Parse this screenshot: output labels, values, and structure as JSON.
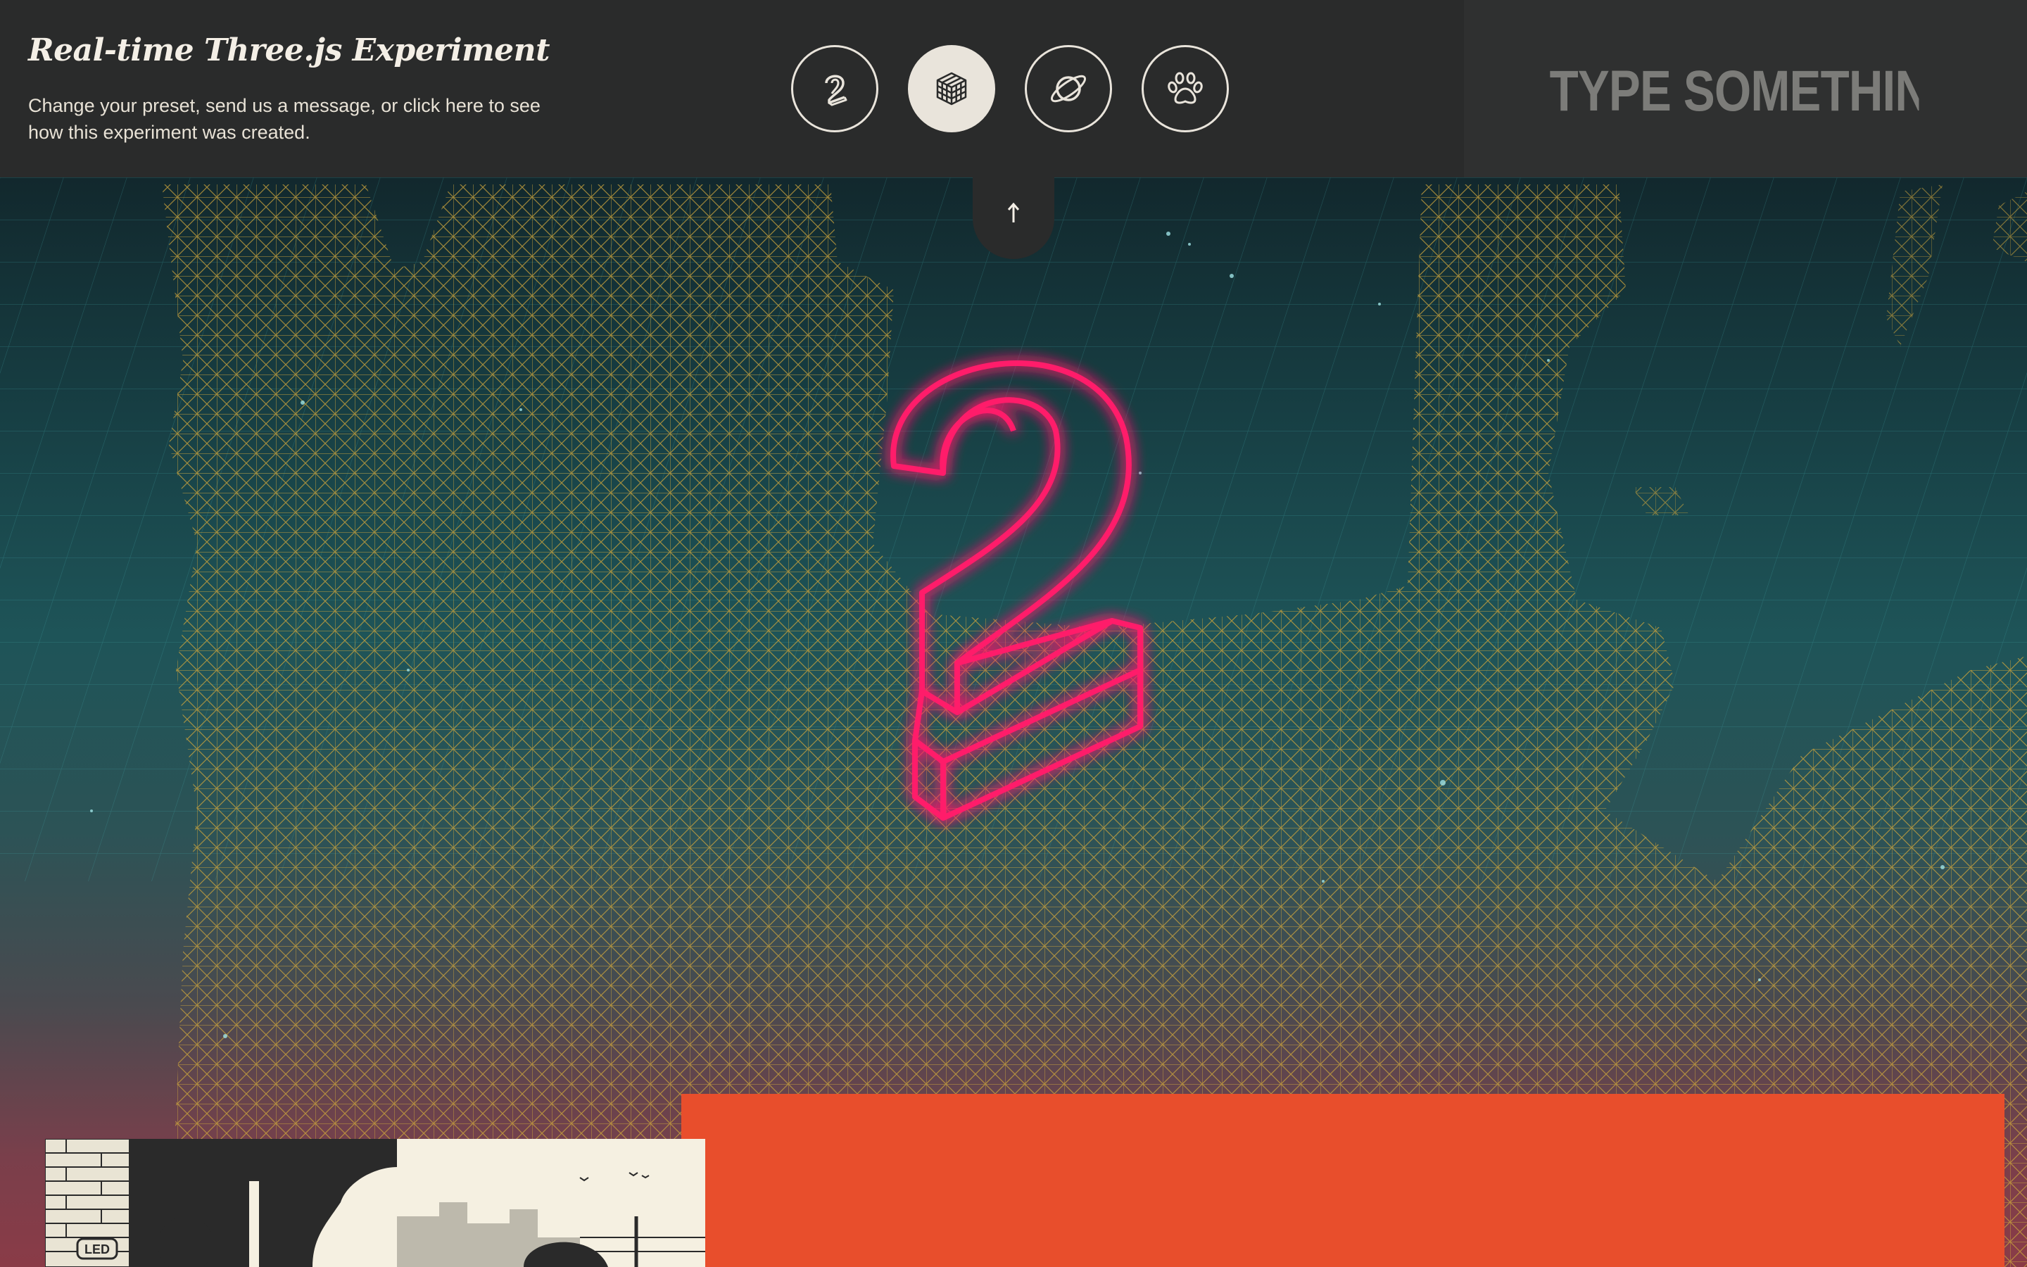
{
  "header": {
    "title": "Real-time Three.js Experiment",
    "description": "Change your preset, send us a message, or click here to see how this experiment was created."
  },
  "presets": [
    {
      "icon": "number-two-icon",
      "active": false
    },
    {
      "icon": "cube-icon",
      "active": true
    },
    {
      "icon": "planet-icon",
      "active": false
    },
    {
      "icon": "paw-icon",
      "active": false
    }
  ],
  "message_input": {
    "placeholder": "TYPE SOMETHING..."
  },
  "collapse": {
    "icon": "arrow-up-icon"
  },
  "scene": {
    "displayed_text": "2",
    "neon_color": "#ff1f6a"
  },
  "colors": {
    "topbar": "#2a2b2b",
    "accent_orange": "#e84e2c",
    "icon_light": "#e9e4db"
  },
  "comic_card": {
    "sign_text": "LED"
  }
}
